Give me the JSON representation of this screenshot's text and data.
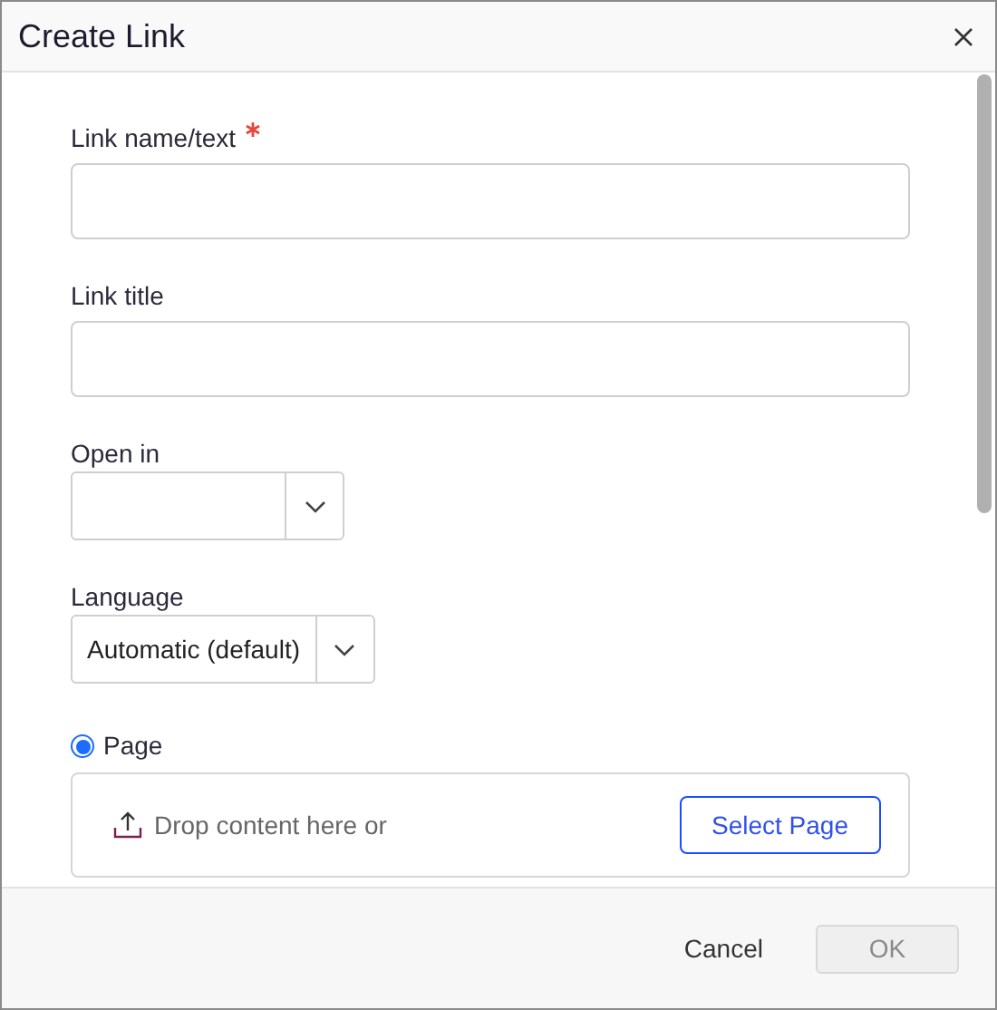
{
  "window": {
    "title": "Create Link"
  },
  "fields": [
    {
      "kind": "text",
      "label": "Link name/text",
      "required": true
    },
    {
      "kind": "text",
      "label": "Link title",
      "required": false
    },
    {
      "kind": "select",
      "label": "Open in",
      "required": false
    },
    {
      "kind": "select",
      "label": "Language",
      "required": false,
      "value": "Automatic (default)"
    }
  ],
  "link_type": {
    "label": "Page",
    "selected": true,
    "dropzone_text": "Drop content here or",
    "button": "Select Page"
  },
  "buttons": [
    {
      "label": "Cancel",
      "kind": "secondary",
      "disabled": false
    },
    {
      "label": "OK",
      "kind": "primary",
      "disabled": true
    }
  ]
}
